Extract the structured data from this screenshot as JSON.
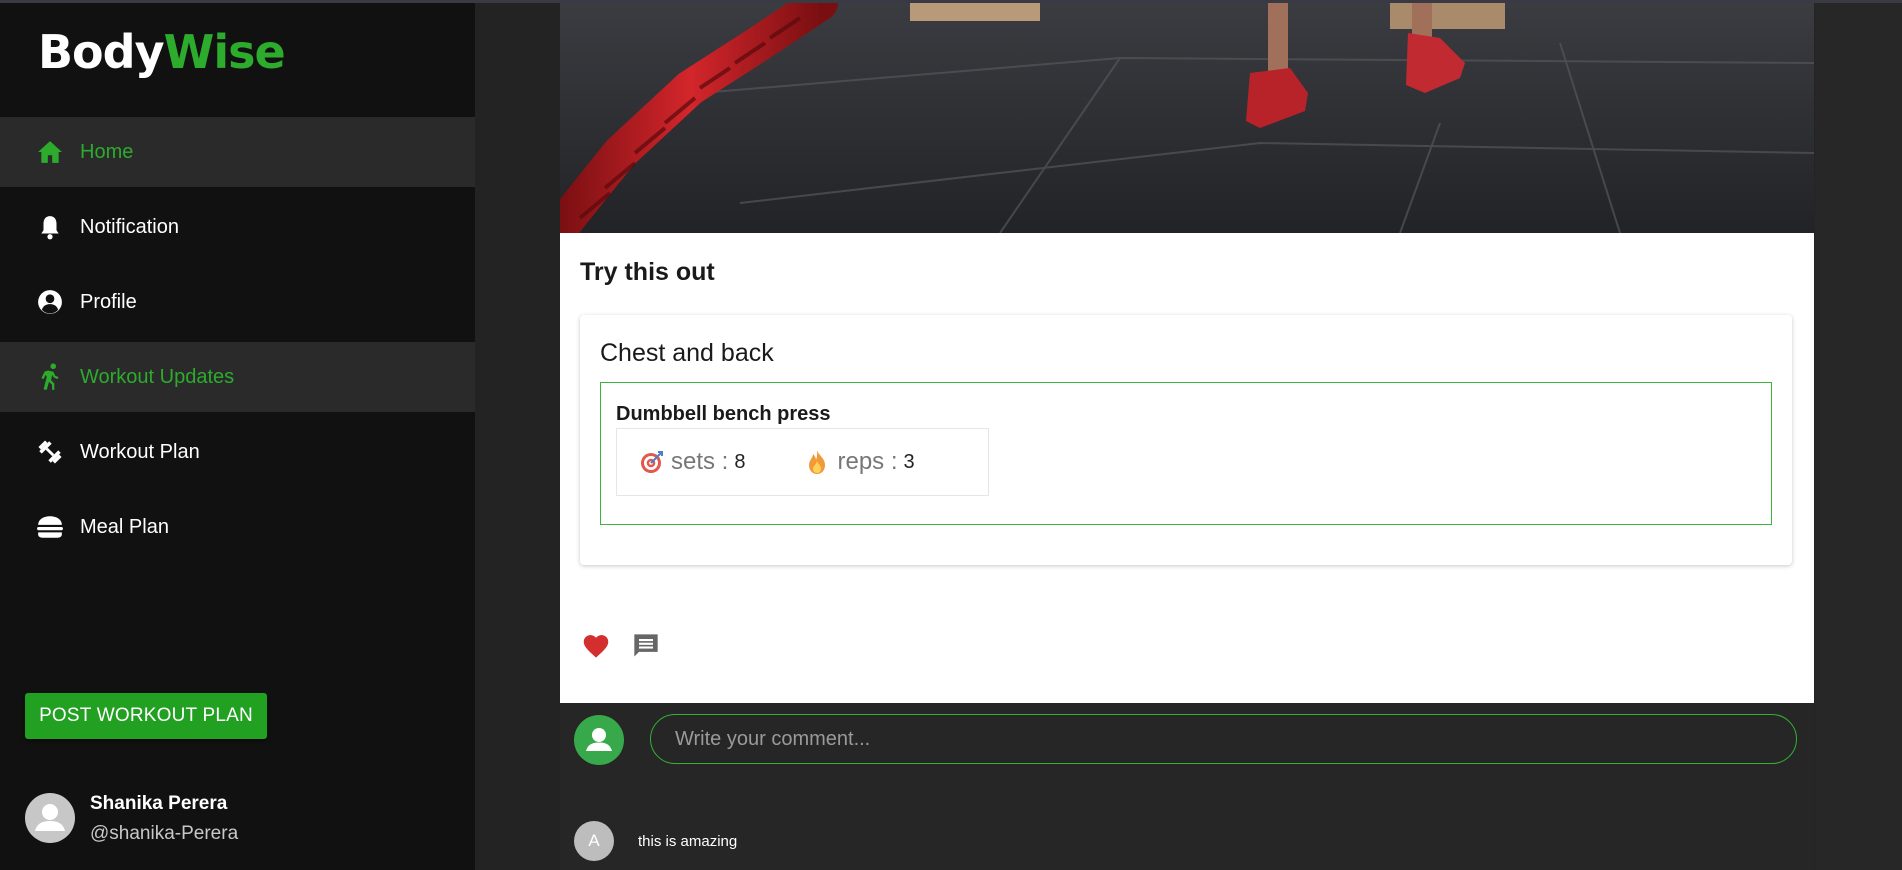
{
  "brand": {
    "part1": "Body",
    "part2": "Wise",
    "accent_color": "#2dab2d"
  },
  "sidebar": {
    "items": [
      {
        "label": "Home",
        "icon": "home-icon",
        "active": true
      },
      {
        "label": "Notification",
        "icon": "bell-icon",
        "active": false
      },
      {
        "label": "Profile",
        "icon": "account-circle-icon",
        "active": false
      },
      {
        "label": "Workout Updates",
        "icon": "running-icon",
        "active": true
      },
      {
        "label": "Workout Plan",
        "icon": "dumbbell-icon",
        "active": false
      },
      {
        "label": "Meal Plan",
        "icon": "burger-icon",
        "active": false
      }
    ],
    "post_button": "POST WORKOUT PLAN",
    "user": {
      "name": "Shanika Perera",
      "handle": "@shanika-Perera"
    }
  },
  "post": {
    "title": "Try this out",
    "plan": {
      "name": "Chest and back",
      "exercises": [
        {
          "name": "Dumbbell bench press",
          "sets_label": "sets :",
          "sets": "8",
          "reps_label": "reps :",
          "reps": "3"
        }
      ]
    },
    "liked": true
  },
  "comments": {
    "input_placeholder": "Write your comment...",
    "items": [
      {
        "avatar_letter": "A",
        "text": "this is amazing"
      }
    ]
  }
}
